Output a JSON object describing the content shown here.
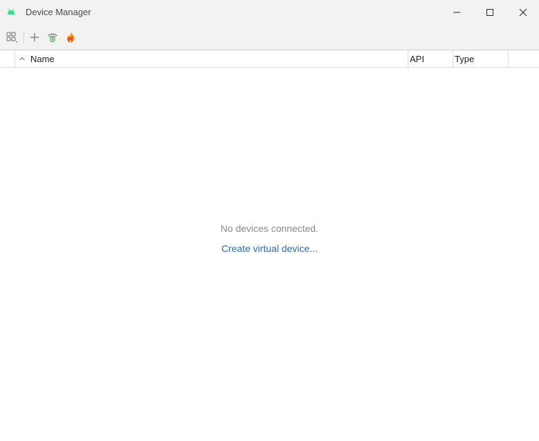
{
  "window": {
    "title": "Device Manager",
    "app_icon": "android-icon",
    "controls": [
      "minimize-icon",
      "maximize-icon",
      "close-icon"
    ]
  },
  "toolbar": {
    "buttons": [
      "grid-options-icon",
      "add-icon",
      "wifi-pair-icon",
      "firebase-icon"
    ]
  },
  "table": {
    "columns": [
      {
        "label": "Name",
        "sort": "ascending"
      },
      {
        "label": "API"
      },
      {
        "label": "Type"
      }
    ]
  },
  "empty_state": {
    "message": "No devices connected.",
    "link": "Create virtual device..."
  },
  "colors": {
    "android_green": "#3ddc84",
    "link_blue": "#2f6ab3",
    "firebase_orange": "#ff7a00",
    "wifi_green": "#4caf50"
  }
}
